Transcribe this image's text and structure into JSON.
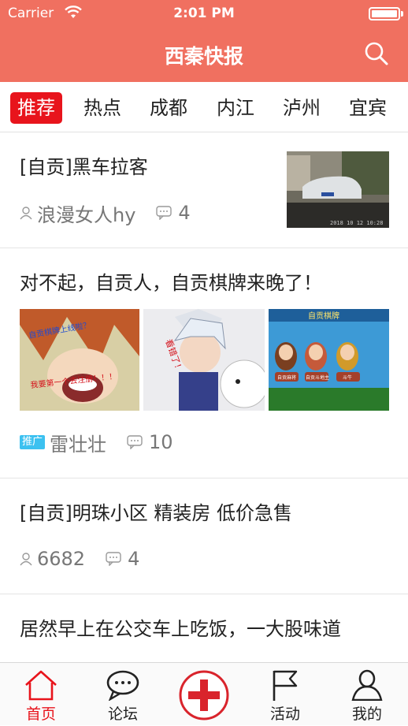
{
  "status": {
    "carrier": "Carrier",
    "time": "2:01 PM",
    "battery_level": 1.0
  },
  "nav": {
    "title": "西秦快报"
  },
  "tabs": [
    {
      "label": "推荐",
      "active": true
    },
    {
      "label": "热点"
    },
    {
      "label": "成都"
    },
    {
      "label": "内江"
    },
    {
      "label": "泸州"
    },
    {
      "label": "宜宾"
    }
  ],
  "articles": [
    {
      "headline": "[自贡]黑车拉客",
      "author": "浪漫女人hy",
      "comments": "4",
      "thumb_caption": "2018 10 12 10:28"
    },
    {
      "headline": "对不起，自贡人，自贡棋牌来晚了！",
      "badge": "推广",
      "author": "雷壮壮",
      "comments": "10",
      "img1_text_a": "自贡棋牌上线啦？",
      "img1_text_b": "我要第一个去注册！！！",
      "img2_text": "看错了！",
      "img3_title": "自贡棋牌",
      "img3_labels": [
        "自贡麻将",
        "自贡斗地主",
        "斗牛"
      ]
    },
    {
      "headline": "[自贡]明珠小区  精装房  低价急售",
      "author": "6682",
      "comments": "4"
    },
    {
      "headline": "居然早上在公交车上吃饭，一大股味道"
    }
  ],
  "bottom_tabs": [
    {
      "label": "首页",
      "icon": "home-icon",
      "active": true
    },
    {
      "label": "论坛",
      "icon": "forum-icon"
    },
    {
      "label": "",
      "icon": "plus-icon"
    },
    {
      "label": "活动",
      "icon": "flag-icon"
    },
    {
      "label": "我的",
      "icon": "profile-icon"
    }
  ],
  "colors": {
    "accent": "#f07060",
    "tab_active": "#e8141c",
    "promo": "#3cc1f0"
  }
}
